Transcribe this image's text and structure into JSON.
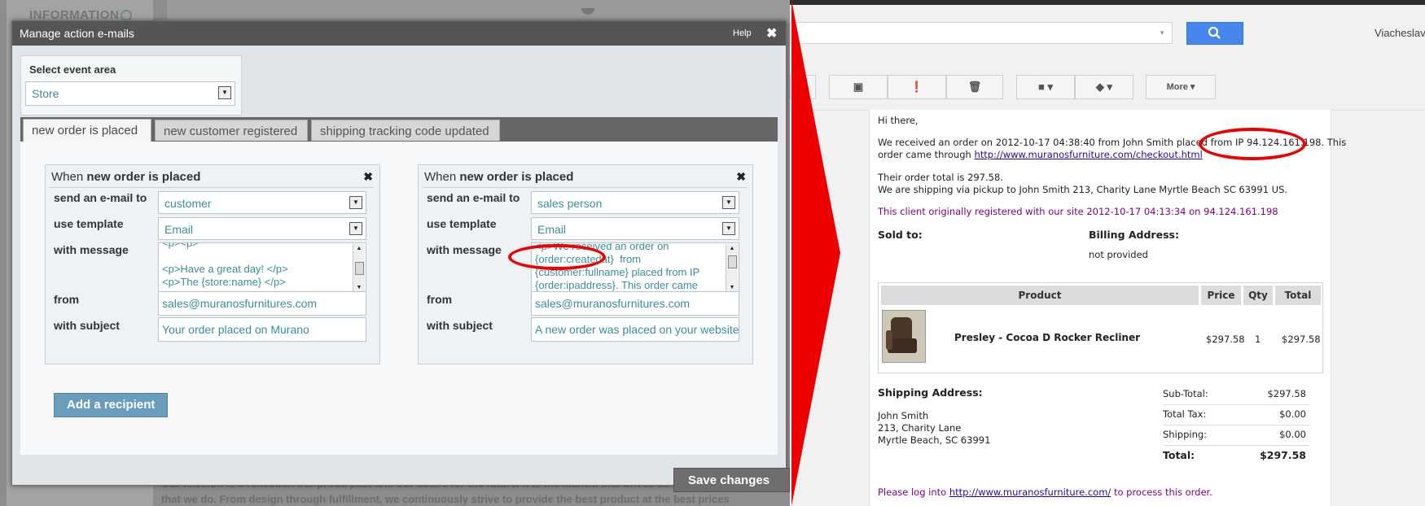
{
  "background_page": {
    "sidebar_heading": "INFORMATION",
    "text_line1": "Our mission is a reflection our proud past and our desire for the future. It is the mantra that drives us in everything",
    "text_line2": "that we do. From design through fulfillment, we continuously strive to provide the best product at the best prices"
  },
  "dialog": {
    "title": "Manage action e-mails",
    "help_label": "Help",
    "close_glyph": "✖",
    "event_area": {
      "label": "Select event area",
      "value": "Store"
    },
    "tabs": [
      {
        "label": "new order is placed"
      },
      {
        "label": "new customer registered"
      },
      {
        "label": "shipping tracking code updated"
      }
    ],
    "field_labels": {
      "send_to": "send an e-mail to",
      "template": "use template",
      "message": "with message",
      "from": "from",
      "subject": "with subject"
    },
    "recipients": [
      {
        "heading_prefix": "When",
        "heading_event": "new order is placed",
        "send_to": "customer",
        "template": "Email",
        "message": "<p><p>\n\n<p>Have a great day! </p>\n<p>The {store:name} </p>",
        "from": "sales@muranosfurnitures.com",
        "subject": "Your order placed on Murano"
      },
      {
        "heading_prefix": "When",
        "heading_event": "new order is placed",
        "send_to": "sales person",
        "template": "Email",
        "message": "<p>We received an order on\n{order:createdat}  from\n{customer:fullname} placed from IP\n{order:ipaddress}. This order came",
        "from": "sales@muranosfurnitures.com",
        "subject": "A new order was placed on your website"
      }
    ],
    "add_recipient_label": "Add a recipient",
    "save_label": "Save changes"
  },
  "gmail": {
    "user_name": "Viacheslav",
    "toolbar": {
      "more_label": "More"
    },
    "email": {
      "greeting": "Hi there,",
      "line1": "We received an order on 2012-10-17 04:38:40 from John Smith placed from IP 94.124.161.198. This",
      "line2_prefix": "order came through",
      "line2_link": "http://www.muranosfurniture.com/checkout.html",
      "total_line": "Their order total is 297.58.",
      "shipping_line": "We are shipping via pickup to John Smith 213, Charity Lane Myrtle Beach SC 63991 US.",
      "registered_line": "This client originally registered with our site 2012-10-17 04:13:34 on 94.124.161.198",
      "sold_to_label": "Sold to:",
      "billing_label": "Billing Address:",
      "billing_value": "not provided",
      "table": {
        "headers": [
          "Product",
          "Price",
          "Qty",
          "Total"
        ],
        "rows": [
          {
            "product": "Presley - Cocoa D Rocker Recliner",
            "price": "$297.58",
            "qty": "1",
            "total": "$297.58"
          }
        ]
      },
      "shipping_address_label": "Shipping Address:",
      "address_lines": [
        "John Smith",
        "213, Charity Lane",
        "Myrtle Beach, SC 63991"
      ],
      "totals": [
        {
          "label": "Sub-Total:",
          "value": "$297.58"
        },
        {
          "label": "Total Tax:",
          "value": "$0.00"
        },
        {
          "label": "Shipping:",
          "value": "$0.00"
        },
        {
          "label": "Total:",
          "value": "$297.58"
        }
      ],
      "footer_prefix": "Please log into",
      "footer_link": "http://www.muranosfurniture.com/",
      "footer_suffix": "to process this order."
    }
  },
  "colors": {
    "annotation_red": "#ee0000",
    "dialog_title_bg": "#555555",
    "accent_blue": "#4787ed"
  }
}
